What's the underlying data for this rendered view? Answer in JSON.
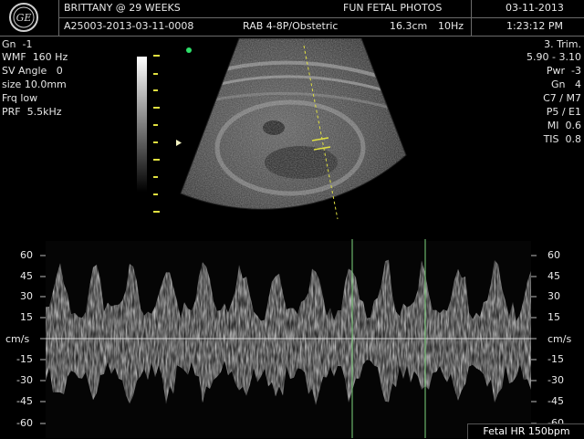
{
  "header": {
    "patient": "BRITTANY @ 29 WEEKS",
    "institution": "FUN FETAL PHOTOS",
    "date": "03-11-2013",
    "exam_id": "A25003-2013-03-11-0008",
    "probe": "RAB 4-8P/Obstetric",
    "depth": "16.3cm",
    "frame_rate": "10Hz",
    "time": "1:23:12 PM",
    "logo_icon": "ge-logo-icon"
  },
  "left_params": {
    "gain": "Gn  -1",
    "wmf": "WMF  160 Hz",
    "sv_angle": "SV Angle   0",
    "size": "size 10.0mm",
    "frq": "Frq low",
    "prf": "PRF  5.5kHz"
  },
  "right_params": {
    "trimester": "3. Trim.",
    "range": "5.90 - 3.10",
    "power": "Pwr  -3",
    "gain": "Gn   4",
    "cm": "C7 / M7",
    "pe": "P5 / E1",
    "mi": "MI  0.6",
    "tis": "TIS  0.8"
  },
  "doppler": {
    "unit": "cm/s",
    "ticks_left": [
      "60",
      "45",
      "30",
      "15",
      "-15",
      "-30",
      "-45",
      "-60"
    ],
    "ticks_right": [
      "60",
      "45",
      "30",
      "15",
      "-15",
      "-30",
      "-45",
      "-60"
    ],
    "heart_rate": "Fetal HR  150bpm",
    "trace_color": "#ffffff",
    "caliper_color": "#7fd67f"
  },
  "scan": {
    "marker_color": "#e0e040",
    "focus_marker_color": "#2ee06a"
  }
}
